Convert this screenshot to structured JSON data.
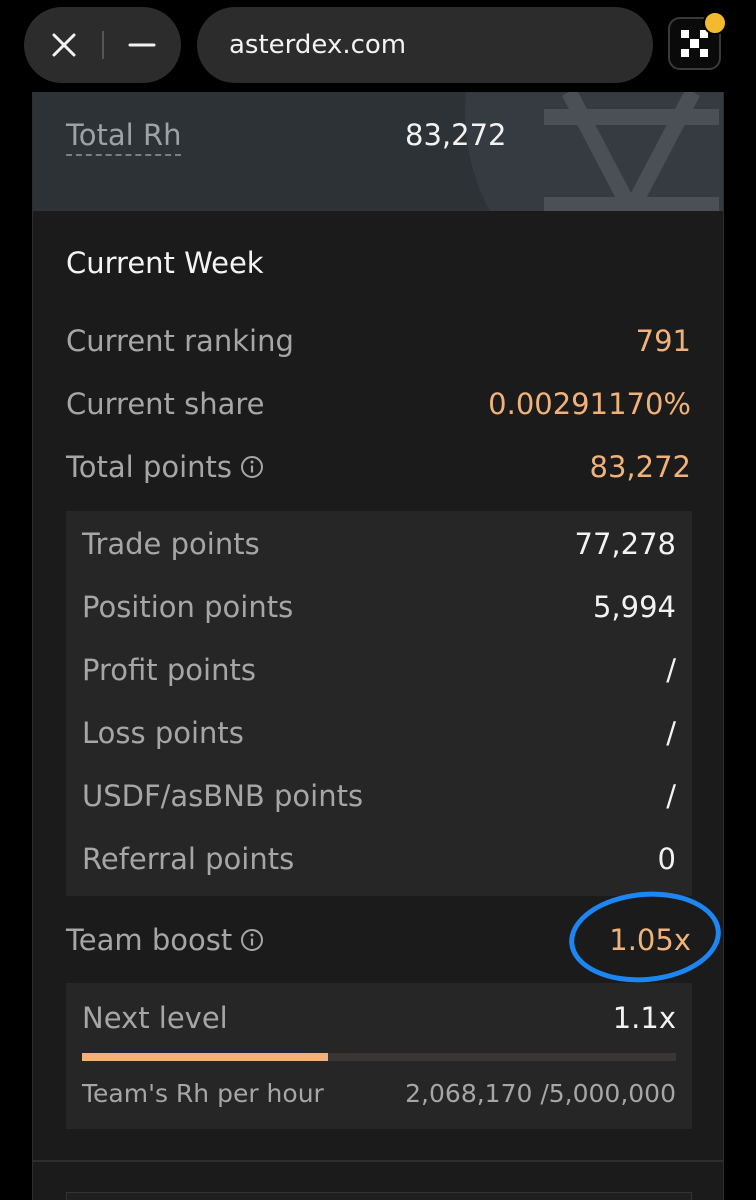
{
  "browser": {
    "url": "asterdex.com",
    "close_icon": "close-icon",
    "minimize_icon": "minimize-icon",
    "wallet_icon": "okx-wallet-icon"
  },
  "summary": {
    "total_label": "Total Rh",
    "total_value": "83,272"
  },
  "current_week": {
    "title": "Current Week",
    "ranking_label": "Current ranking",
    "ranking_value": "791",
    "share_label": "Current share",
    "share_value": "0.00291170%",
    "total_points_label": "Total points",
    "total_points_value": "83,272",
    "breakdown": [
      {
        "label": "Trade points",
        "value": "77,278"
      },
      {
        "label": "Position points",
        "value": "5,994"
      },
      {
        "label": "Profit points",
        "value": "/"
      },
      {
        "label": "Loss points",
        "value": "/"
      },
      {
        "label": "USDF/asBNB points",
        "value": "/"
      },
      {
        "label": "Referral points",
        "value": "0"
      }
    ],
    "team_boost_label": "Team boost",
    "team_boost_value": "1.05x",
    "next_level_label": "Next level",
    "next_level_value": "1.1x",
    "team_rh_label": "Team's Rh per hour",
    "team_rh_value": "2,068,170 /5,000,000",
    "team_rh_progress": 0.414
  },
  "colors": {
    "accent": "#f0b27a",
    "annotation": "#1c86f5",
    "background": "#1b1b1b"
  }
}
